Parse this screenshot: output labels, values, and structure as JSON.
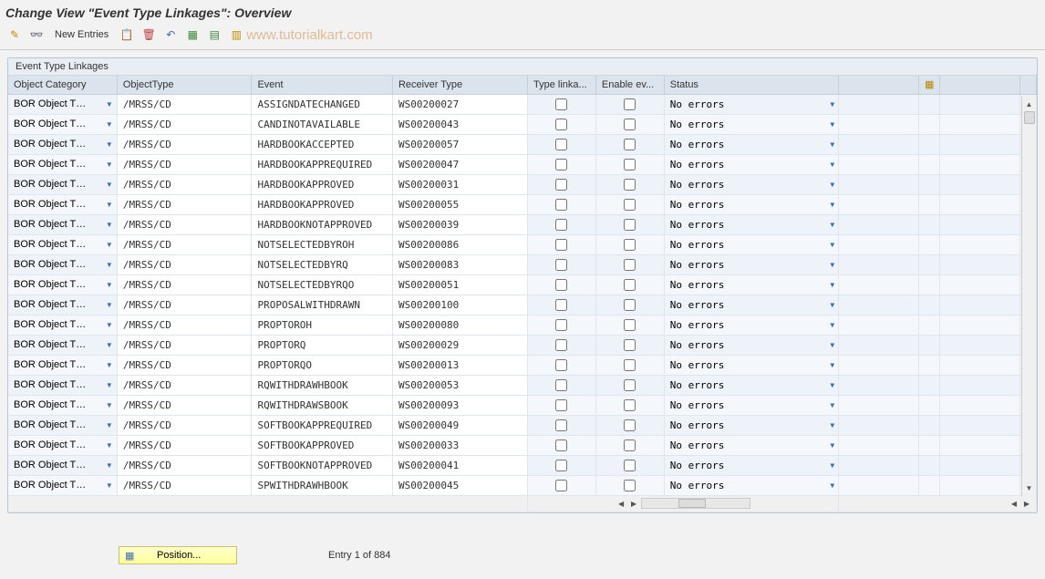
{
  "title": "Change View \"Event Type Linkages\": Overview",
  "toolbar": {
    "new_entries": "New Entries"
  },
  "watermark": "www.tutorialkart.com",
  "panel": {
    "title": "Event Type Linkages"
  },
  "columns": {
    "object_category": "Object Category",
    "object_type": "ObjectType",
    "event": "Event",
    "receiver_type": "Receiver Type",
    "type_linkage": "Type linka...",
    "enable_ev": "Enable ev...",
    "status": "Status"
  },
  "rows": [
    {
      "oc": "BOR Object T…",
      "ot": "/MRSS/CD",
      "ev": "ASSIGNDATECHANGED",
      "rt": "WS00200027",
      "st": "No errors"
    },
    {
      "oc": "BOR Object T…",
      "ot": "/MRSS/CD",
      "ev": "CANDINOTAVAILABLE",
      "rt": "WS00200043",
      "st": "No errors"
    },
    {
      "oc": "BOR Object T…",
      "ot": "/MRSS/CD",
      "ev": "HARDBOOKACCEPTED",
      "rt": "WS00200057",
      "st": "No errors"
    },
    {
      "oc": "BOR Object T…",
      "ot": "/MRSS/CD",
      "ev": "HARDBOOKAPPREQUIRED",
      "rt": "WS00200047",
      "st": "No errors"
    },
    {
      "oc": "BOR Object T…",
      "ot": "/MRSS/CD",
      "ev": "HARDBOOKAPPROVED",
      "rt": "WS00200031",
      "st": "No errors"
    },
    {
      "oc": "BOR Object T…",
      "ot": "/MRSS/CD",
      "ev": "HARDBOOKAPPROVED",
      "rt": "WS00200055",
      "st": "No errors"
    },
    {
      "oc": "BOR Object T…",
      "ot": "/MRSS/CD",
      "ev": "HARDBOOKNOTAPPROVED",
      "rt": "WS00200039",
      "st": "No errors"
    },
    {
      "oc": "BOR Object T…",
      "ot": "/MRSS/CD",
      "ev": "NOTSELECTEDBYROH",
      "rt": "WS00200086",
      "st": "No errors"
    },
    {
      "oc": "BOR Object T…",
      "ot": "/MRSS/CD",
      "ev": "NOTSELECTEDBYRQ",
      "rt": "WS00200083",
      "st": "No errors"
    },
    {
      "oc": "BOR Object T…",
      "ot": "/MRSS/CD",
      "ev": "NOTSELECTEDBYRQO",
      "rt": "WS00200051",
      "st": "No errors"
    },
    {
      "oc": "BOR Object T…",
      "ot": "/MRSS/CD",
      "ev": "PROPOSALWITHDRAWN",
      "rt": "WS00200100",
      "st": "No errors"
    },
    {
      "oc": "BOR Object T…",
      "ot": "/MRSS/CD",
      "ev": "PROPTOROH",
      "rt": "WS00200080",
      "st": "No errors"
    },
    {
      "oc": "BOR Object T…",
      "ot": "/MRSS/CD",
      "ev": "PROPTORQ",
      "rt": "WS00200029",
      "st": "No errors"
    },
    {
      "oc": "BOR Object T…",
      "ot": "/MRSS/CD",
      "ev": "PROPTORQO",
      "rt": "WS00200013",
      "st": "No errors"
    },
    {
      "oc": "BOR Object T…",
      "ot": "/MRSS/CD",
      "ev": "RQWITHDRAWHBOOK",
      "rt": "WS00200053",
      "st": "No errors"
    },
    {
      "oc": "BOR Object T…",
      "ot": "/MRSS/CD",
      "ev": "RQWITHDRAWSBOOK",
      "rt": "WS00200093",
      "st": "No errors"
    },
    {
      "oc": "BOR Object T…",
      "ot": "/MRSS/CD",
      "ev": "SOFTBOOKAPPREQUIRED",
      "rt": "WS00200049",
      "st": "No errors"
    },
    {
      "oc": "BOR Object T…",
      "ot": "/MRSS/CD",
      "ev": "SOFTBOOKAPPROVED",
      "rt": "WS00200033",
      "st": "No errors"
    },
    {
      "oc": "BOR Object T…",
      "ot": "/MRSS/CD",
      "ev": "SOFTBOOKNOTAPPROVED",
      "rt": "WS00200041",
      "st": "No errors"
    },
    {
      "oc": "BOR Object T…",
      "ot": "/MRSS/CD",
      "ev": "SPWITHDRAWHBOOK",
      "rt": "WS00200045",
      "st": "No errors"
    }
  ],
  "position_button": "Position...",
  "entry_text": "Entry 1 of 884"
}
